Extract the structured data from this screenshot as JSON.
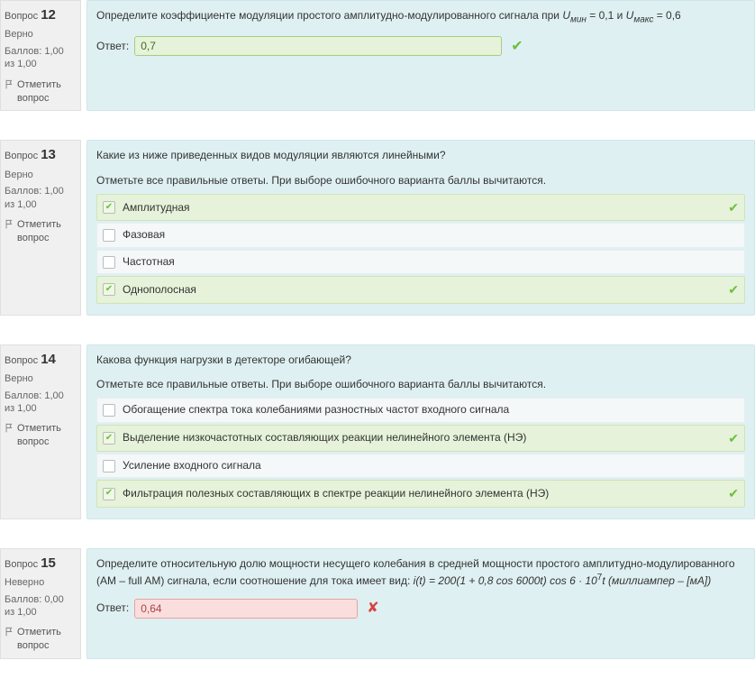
{
  "labels": {
    "question": "Вопрос",
    "flag": "Отметить вопрос",
    "answer": "Ответ:"
  },
  "questions": [
    {
      "number": "12",
      "state": "Верно",
      "grade": "Баллов: 1,00 из 1,00",
      "text_a": "Определите коэффициенте модуляции простого амплитудно-модулированного сигнала при ",
      "var1": "U",
      "sub1": "мин",
      "eq1": " = 0,1 и ",
      "var2": "U",
      "sub2": "макс",
      "eq2": " = 0,6",
      "answer": "0,7",
      "kind": "input_correct"
    },
    {
      "number": "13",
      "state": "Верно",
      "grade": "Баллов: 1,00 из 1,00",
      "text": "Какие из ниже приведенных видов модуляции являются линейными?",
      "instr": "Отметьте все правильные ответы. При выборе ошибочного варианта баллы вычитаются.",
      "kind": "multi",
      "options": [
        {
          "label": "Амплитудная",
          "selected": true,
          "tick": true
        },
        {
          "label": "Фазовая",
          "selected": false,
          "tick": false
        },
        {
          "label": "Частотная",
          "selected": false,
          "tick": false
        },
        {
          "label": "Однополосная",
          "selected": true,
          "tick": true
        }
      ]
    },
    {
      "number": "14",
      "state": "Верно",
      "grade": "Баллов: 1,00 из 1,00",
      "text": "Какова функция нагрузки в детекторе огибающей?",
      "instr": "Отметьте все правильные ответы. При выборе ошибочного варианта баллы вычитаются.",
      "kind": "multi",
      "options": [
        {
          "label": "Обогащение спектра тока колебаниями разностных частот входного сигнала",
          "selected": false,
          "tick": false
        },
        {
          "label": "Выделение низкочастотных составляющих реакции нелинейного элемента (НЭ)",
          "selected": true,
          "tick": true
        },
        {
          "label": "Усиление входного сигнала",
          "selected": false,
          "tick": false
        },
        {
          "label": "Фильтрация полезных составляющих в спектре реакции нелинейного элемента (НЭ)",
          "selected": true,
          "tick": true
        }
      ]
    },
    {
      "number": "15",
      "state": "Неверно",
      "grade": "Баллов: 0,00 из 1,00",
      "text_a": "Определите относительную долю мощности несущего колебания в средней мощности простого амплитудно-модулированного (АМ – full AM) сигнала, если соотношение для тока имеет вид: ",
      "formula": "i(t) = 200(1 + 0,8 cos 6000t) cos 6 · 10",
      "sup": "7",
      "tail": "t (миллиампер – [мА])",
      "answer": "0,64",
      "kind": "input_incorrect"
    }
  ]
}
